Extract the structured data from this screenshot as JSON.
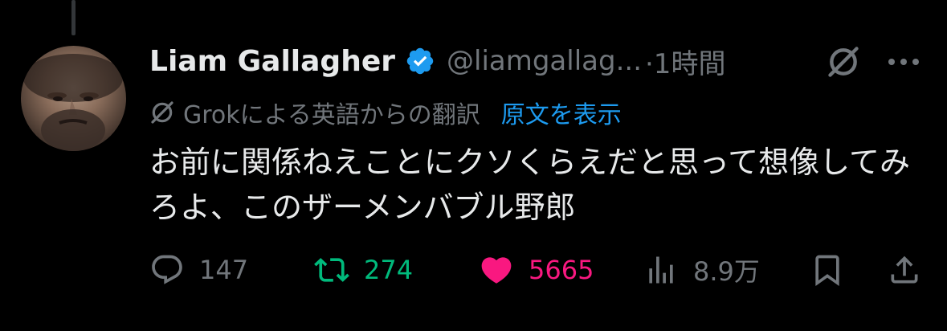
{
  "post": {
    "author_name": "Liam Gallagher",
    "handle": "@liamgallag...",
    "time": "·1時間",
    "translation_note": "Grokによる英語からの翻訳",
    "show_original": "原文を表示",
    "text": "お前に関係ねえことにクソくらえだと思って想像してみろよ、このザーメンバブル野郎"
  },
  "actions": {
    "replies": "147",
    "reposts": "274",
    "likes": "5665",
    "views": "8.9万"
  },
  "icons": {
    "verified": "verified-badge-icon",
    "grok": "grok-icon",
    "more": "more-icon",
    "reply": "reply-icon",
    "retweet": "retweet-icon",
    "like": "heart-icon",
    "views": "views-icon",
    "bookmark": "bookmark-icon",
    "share": "share-icon"
  },
  "colors": {
    "background": "#000000",
    "text": "#e7e9ea",
    "secondary": "#71767b",
    "link": "#1d9bf0",
    "retweet": "#00ba7c",
    "like": "#f91880",
    "verified": "#1d9bf0"
  },
  "state": {
    "liked": true,
    "retweeted": true
  }
}
